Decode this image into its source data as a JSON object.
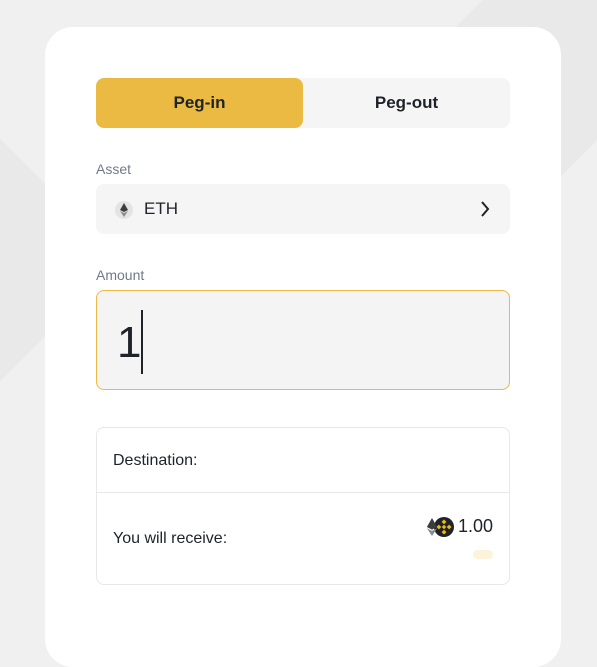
{
  "tabs": [
    {
      "label": "Peg-in",
      "active": true
    },
    {
      "label": "Peg-out",
      "active": false
    }
  ],
  "asset": {
    "label": "Asset",
    "selected": "ETH",
    "icon": "eth-icon"
  },
  "amount": {
    "label": "Amount",
    "value": "1"
  },
  "info": {
    "destination_label": "Destination:",
    "receive_label": "You will receive:",
    "receive_value": "1.00",
    "receive_icons": [
      "eth-icon",
      "bnb-icon"
    ]
  },
  "colors": {
    "accent": "#ebba43",
    "background": "#f0f0f0",
    "card": "#ffffff",
    "field": "#f5f5f5",
    "label": "#707a8a",
    "text": "#1e2329"
  }
}
